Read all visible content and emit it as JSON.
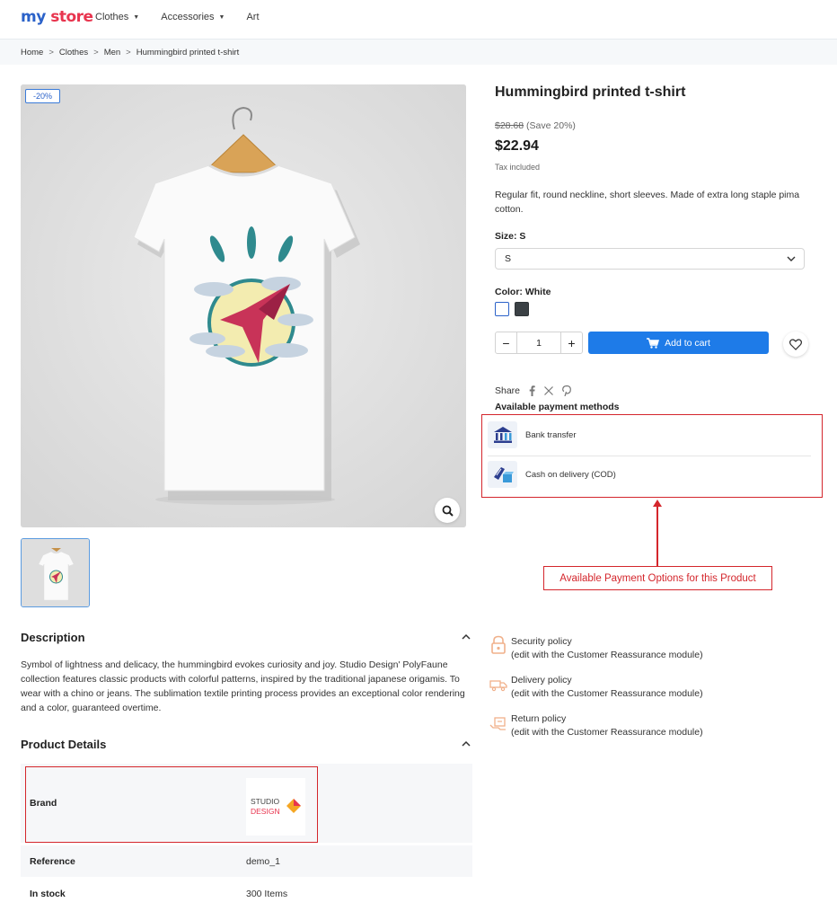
{
  "header": {
    "logo_my": "my",
    "logo_store": "store",
    "nav": [
      {
        "label": "Clothes",
        "has_caret": true
      },
      {
        "label": "Accessories",
        "has_caret": true
      },
      {
        "label": "Art",
        "has_caret": false
      }
    ]
  },
  "breadcrumb": [
    "Home",
    "Clothes",
    "Men",
    "Hummingbird printed t-shirt"
  ],
  "breadcrumb_separator": ">",
  "gallery": {
    "discount_badge": "-20%",
    "zoom_icon": "search-icon"
  },
  "product": {
    "title": "Hummingbird printed t-shirt",
    "old_price": "$28.68",
    "save": "(Save 20%)",
    "price": "$22.94",
    "tax": "Tax included",
    "short_description": "Regular fit, round neckline, short sleeves. Made of extra long staple pima cotton.",
    "size_label": "Size: S",
    "size_value": "S",
    "color_label": "Color: White",
    "quantity": "1",
    "add_to_cart": "Add to cart",
    "accent_color": "#1e7be8"
  },
  "share": {
    "label": "Share",
    "icons": [
      "facebook-icon",
      "x-icon",
      "pinterest-icon"
    ]
  },
  "payment": {
    "title": "Available payment methods",
    "methods": [
      {
        "label": "Bank transfer",
        "icon": "bank-icon"
      },
      {
        "label": "Cash on delivery (COD)",
        "icon": "cash-delivery-icon"
      }
    ]
  },
  "annotation": {
    "label": "Available Payment Options for this Product",
    "color": "#d4262c"
  },
  "reassurance": [
    {
      "title": "Security policy",
      "subtitle": "(edit with the Customer Reassurance module)",
      "icon": "lock-icon"
    },
    {
      "title": "Delivery policy",
      "subtitle": "(edit with the Customer Reassurance module)",
      "icon": "truck-icon"
    },
    {
      "title": "Return policy",
      "subtitle": "(edit with the Customer Reassurance module)",
      "icon": "return-icon"
    }
  ],
  "description": {
    "title": "Description",
    "text": "Symbol of lightness and delicacy, the hummingbird evokes curiosity and joy. Studio Design' PolyFaune collection features classic products with colorful patterns, inspired by the traditional japanese origamis. To wear with a chino or jeans. The sublimation textile printing process provides an exceptional color rendering and a color, guaranteed overtime."
  },
  "details": {
    "title": "Product Details",
    "rows": [
      {
        "key": "Brand",
        "value": ""
      },
      {
        "key": "Reference",
        "value": "demo_1"
      },
      {
        "key": "In stock",
        "value": "300 Items"
      }
    ],
    "brand_logo_line1": "STUDIO",
    "brand_logo_line2": "DESIGN"
  }
}
